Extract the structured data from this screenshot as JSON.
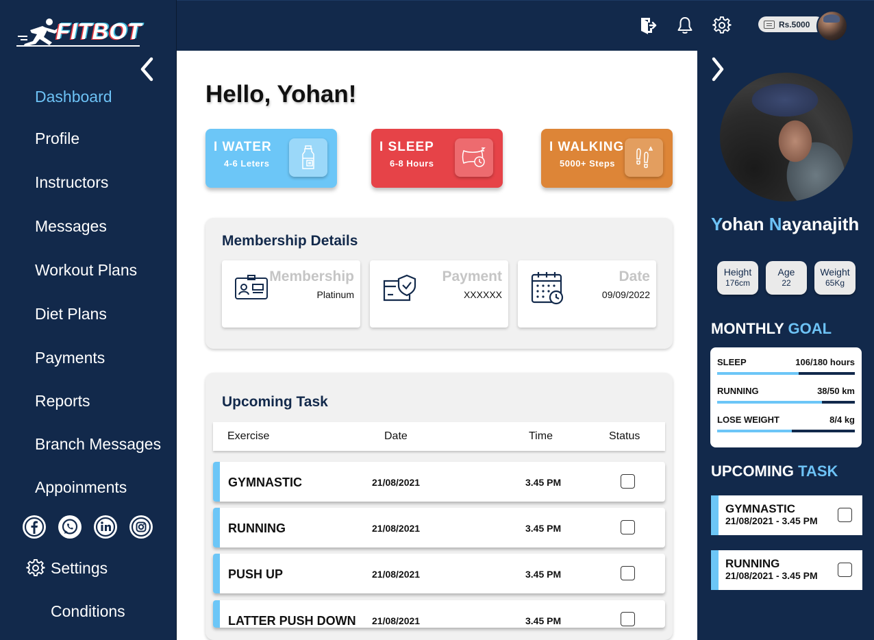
{
  "brand": {
    "name": "FITBOT"
  },
  "sidebar": {
    "items": [
      {
        "label": "Dashboard"
      },
      {
        "label": "Profile"
      },
      {
        "label": "Instructors"
      },
      {
        "label": "Messages"
      },
      {
        "label": "Workout Plans"
      },
      {
        "label": "Diet Plans"
      },
      {
        "label": "Payments"
      },
      {
        "label": "Reports"
      },
      {
        "label": "Branch Messages"
      },
      {
        "label": "Appoinments"
      }
    ],
    "active_index": 0,
    "social": [
      "facebook-icon",
      "whatsapp-icon",
      "linkedin-icon",
      "instagram-icon"
    ],
    "settings_label": "Settings",
    "conditions_label": "Conditions"
  },
  "topbar": {
    "icons": [
      "logout-icon",
      "bell-icon",
      "gear-icon"
    ],
    "balance": "Rs.5000"
  },
  "main": {
    "greeting": "Hello, Yohan!",
    "stats": [
      {
        "title": "I WATER",
        "sub": "4-6 Leters",
        "icon": "water-bottle-icon",
        "color": "#6cc6f7"
      },
      {
        "title": "I SLEEP",
        "sub": "6-8 Hours",
        "icon": "pillow-clock-icon",
        "color": "#e64348"
      },
      {
        "title": "I WALKING",
        "sub": "5000+ Steps",
        "icon": "footsteps-icon",
        "color": "#dd8537"
      }
    ],
    "membership": {
      "title": "Membership Details",
      "items": [
        {
          "label": "Membership",
          "value": "Platinum",
          "icon": "id-card-icon"
        },
        {
          "label": "Payment",
          "value": "XXXXXX",
          "icon": "shield-card-icon"
        },
        {
          "label": "Date",
          "value": "09/09/2022",
          "icon": "calendar-clock-icon"
        }
      ]
    },
    "upcoming": {
      "title": "Upcoming Task",
      "columns": [
        "Exercise",
        "Date",
        "Time",
        "Status"
      ],
      "rows": [
        {
          "exercise": "GYMNASTIC",
          "date": "21/08/2021",
          "time": "3.45 PM"
        },
        {
          "exercise": "RUNNING",
          "date": "21/08/2021",
          "time": "3.45 PM"
        },
        {
          "exercise": "PUSH UP",
          "date": "21/08/2021",
          "time": "3.45 PM"
        },
        {
          "exercise": "LATTER PUSH DOWN",
          "date": "21/08/2021",
          "time": "3.45 PM"
        }
      ]
    }
  },
  "profile": {
    "first_initial": "Y",
    "first_rest": "ohan ",
    "last_initial": "N",
    "last_rest": "ayanajith",
    "stats": [
      {
        "label": "Height",
        "value": "176cm"
      },
      {
        "label": "Age",
        "value": "22"
      },
      {
        "label": "Weight",
        "value": "65Kg"
      }
    ],
    "goal_title_a": "MONTHLY ",
    "goal_title_b": "GOAL",
    "goals": [
      {
        "label": "SLEEP",
        "value": "106/180 hours",
        "progress": 0.59
      },
      {
        "label": "RUNNING",
        "value": "38/50 km",
        "progress": 0.76
      },
      {
        "label": "LOSE WEIGHT",
        "value": "8/4 kg",
        "progress": 0.54
      }
    ],
    "task_title_a": "UPCOMING ",
    "task_title_b": "TASK",
    "tasks": [
      {
        "name": "GYMNASTIC",
        "when": "21/08/2021 - 3.45 PM"
      },
      {
        "name": "RUNNING",
        "when": "21/08/2021 - 3.45 PM"
      }
    ]
  }
}
